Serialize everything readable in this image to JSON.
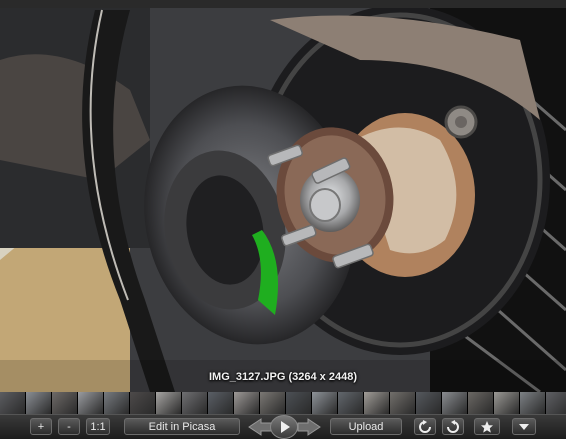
{
  "photo": {
    "caption": "IMG_3127.JPG (3264 x 2448)",
    "subject_icon": "car-wheel-hub-photo"
  },
  "filmstrip": {
    "thumb_colors": [
      "#5c5d61",
      "#8b8f95",
      "#6e6a68",
      "#9a9ca0",
      "#777b80",
      "#4d4a4a",
      "#a7a5a3",
      "#6f6f72",
      "#5a5f66",
      "#9d9997",
      "#7b7874",
      "#4c5055",
      "#8e9399",
      "#62676d",
      "#a19d98",
      "#726f6b",
      "#55595e",
      "#8a8d91",
      "#6b6864",
      "#9b9995",
      "#7d8185",
      "#5f6064"
    ]
  },
  "toolbar": {
    "zoom_in_label": "+",
    "zoom_out_label": "-",
    "actual_size_label": "1:1",
    "edit_label": "Edit in Picasa",
    "upload_label": "Upload"
  }
}
